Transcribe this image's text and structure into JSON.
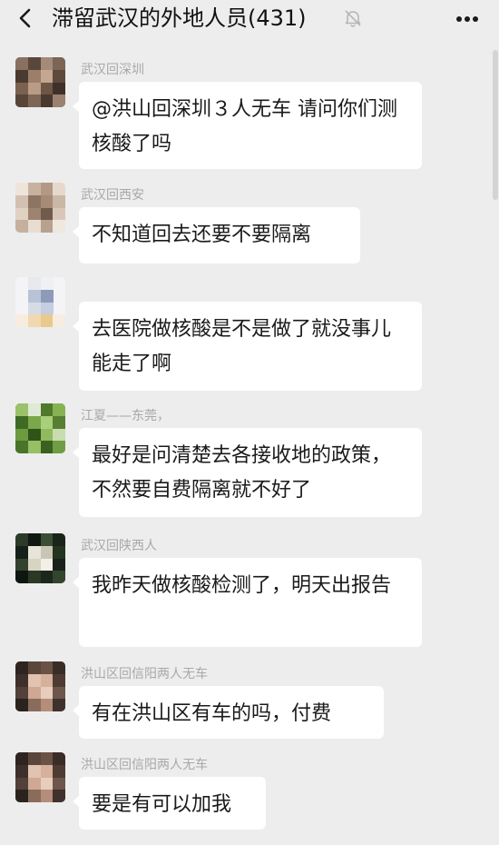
{
  "header": {
    "title": "滞留武汉的外地人员(431)",
    "back_icon": "back-chevron-icon",
    "mute_icon": "mute-bell-icon",
    "more_icon": "more-dots-icon"
  },
  "messages": [
    {
      "sender": "武汉回深圳",
      "text": "@洪山回深圳３人无车  请问你们测核酸了吗",
      "avatar": "avatar-blurred-brown"
    },
    {
      "sender": "武汉回西安",
      "text": "不知道回去还要不要隔离",
      "avatar": "avatar-blurred-beige"
    },
    {
      "sender": "",
      "text": "去医院做核酸是不是做了就没事儿能走了啊",
      "avatar": "avatar-blurred-white-bottle"
    },
    {
      "sender": "江夏——东莞，",
      "text": "最好是问清楚去各接收地的政策，不然要自费隔离就不好了",
      "avatar": "avatar-blurred-green-plant"
    },
    {
      "sender": "武汉回陕西人",
      "text": "我昨天做核酸检测了，明天出报告",
      "avatar": "avatar-blurred-dark-flower"
    },
    {
      "sender": "洪山区回信阳两人无车",
      "text": "有在洪山区有车的吗，付费",
      "avatar": "avatar-blurred-person"
    },
    {
      "sender": "洪山区回信阳两人无车",
      "text": "要是有可以加我",
      "avatar": "avatar-blurred-person"
    }
  ],
  "colors": {
    "background": "#ededed",
    "bubble": "#ffffff",
    "sender_text": "#a8a8a8",
    "message_text": "#1a1a1a"
  }
}
